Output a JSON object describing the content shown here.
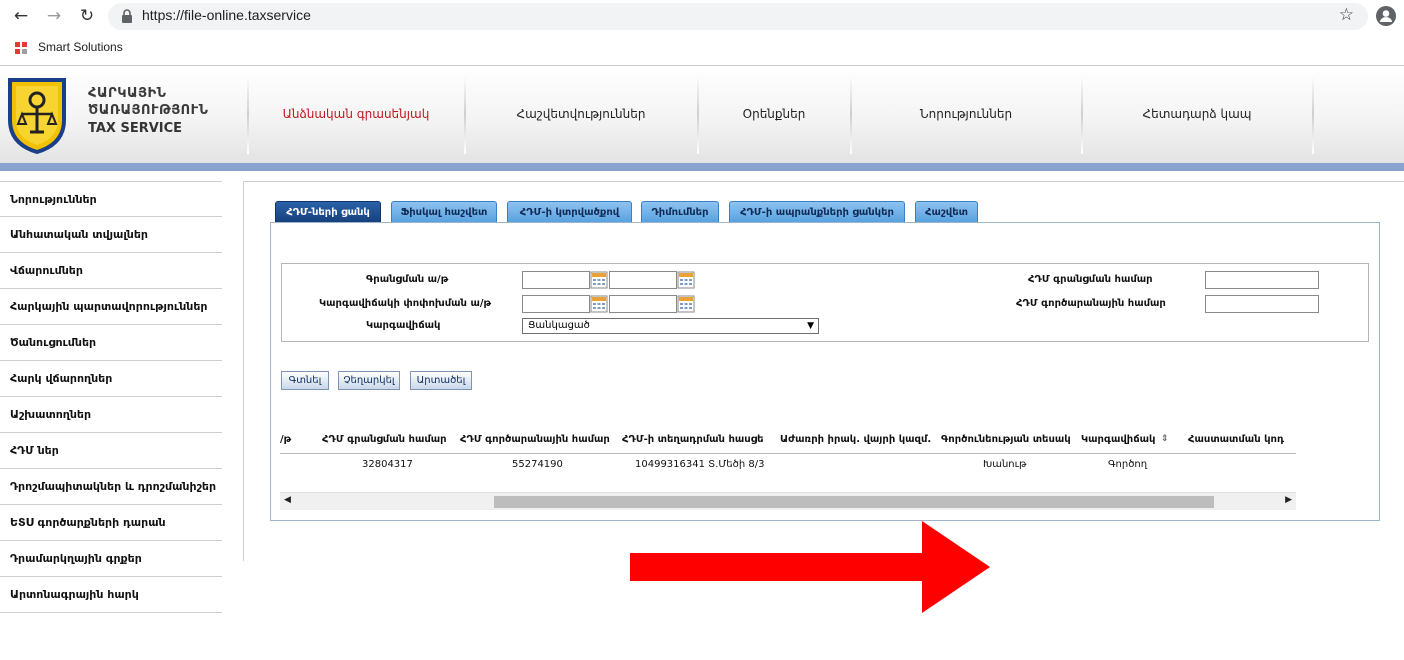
{
  "browser": {
    "url": "https://file-online.taxservice",
    "bookmark_label": "Smart Solutions"
  },
  "header": {
    "logo_line1": "ՀԱՐԿԱՅԻՆ",
    "logo_line2": "ԾԱՌԱՅՈՒԹՅՈՒՆ",
    "logo_line3": "TAX SERVICE",
    "nav": [
      {
        "label": "Անձնական գրասենյակ"
      },
      {
        "label": "Հաշվետվություններ"
      },
      {
        "label": "Օրենքներ"
      },
      {
        "label": "Նորություններ"
      },
      {
        "label": "Հետադարձ կապ"
      }
    ]
  },
  "sidebar": {
    "items": [
      {
        "label": "Նորություններ"
      },
      {
        "label": "Անհատական տվյալներ"
      },
      {
        "label": "Վճարումներ"
      },
      {
        "label": "Հարկային պարտավորություններ"
      },
      {
        "label": "Ծանուցումներ"
      },
      {
        "label": "Հարկ վճարողներ"
      },
      {
        "label": "Աշխատողներ"
      },
      {
        "label": "ՀԴՄ ներ"
      },
      {
        "label": "Դրոշմապիտակներ և դրոշմանիշեր"
      },
      {
        "label": "ԵՏՍ գործարքների դարան"
      },
      {
        "label": "Դրամարկղային գրքեր"
      },
      {
        "label": "Արտոնագրային հարկ"
      }
    ]
  },
  "tabs": [
    {
      "label": "ՀԴՄ-ների ցանկ"
    },
    {
      "label": "Ֆիսկալ հաշվետ"
    },
    {
      "label": "ՀԴՄ-ի կտրվածքով"
    },
    {
      "label": "Դիմումներ"
    },
    {
      "label": "ՀԴՄ-ի ապրանքների ցանկեր"
    },
    {
      "label": "Հաշվետ"
    }
  ],
  "filters": {
    "reg_seq_label": "Գրանցման ա/թ",
    "status_change_label": "Կարգավիճակի փոփոխման ա/թ",
    "status_label": "Կարգավիճակ",
    "status_value": "Ցանկացած",
    "reg_number_label": "ՀԴՄ գրանցման համար",
    "factory_number_label": "ՀԴՄ գործարանային համար"
  },
  "actions": {
    "find": "Գտնել",
    "cancel": "Չեղարկել",
    "export": "Արտածել"
  },
  "grid": {
    "columns": [
      "/թ",
      "ՀԴՄ գրանցման համար",
      "ՀԴՄ գործարանային համար",
      "ՀԴՄ-ի տեղադրման հասցե",
      "Աժառրի իրակ. վայրի կազմ.",
      "Գործունեության տեսակ",
      "Կարգավիճակ",
      "Հաստատման կոդ"
    ],
    "rows": [
      {
        "reg_number": "32804317",
        "factory_number": "55274190",
        "address": "10499316341 Տ.Մեծի 8/3",
        "activity": "Խանութ",
        "status": "Գործող"
      }
    ]
  },
  "icons": {
    "back": "arrow-left-icon",
    "forward": "arrow-right-icon",
    "reload": "reload-icon",
    "lock": "lock-icon",
    "star": "star-icon",
    "profile": "profile-icon",
    "calendar": "calendar-icon",
    "sort": "sort-icon",
    "annotation": "red-arrow-icon"
  },
  "colors": {
    "active_nav": "#c0161e",
    "tab": "#56a1e0",
    "tab_active": "#163f7a",
    "header_band": "#8aa2cf",
    "annotation_arrow": "#ff0000"
  }
}
